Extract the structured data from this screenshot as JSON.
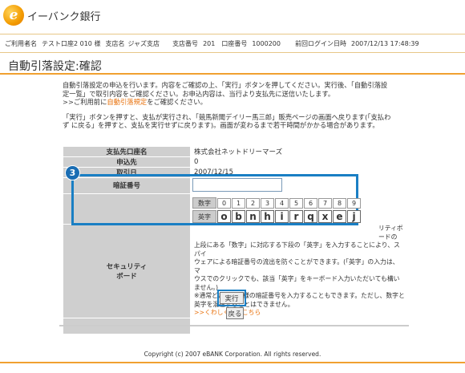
{
  "brand": {
    "logo_letter": "e",
    "name": "イーバンク銀行"
  },
  "info_bar": {
    "user_label": "ご利用者名",
    "user_name": "テスト口座2 010 様",
    "branch_label": "支店名",
    "branch_name": "ジャズ支店",
    "branch_no_label": "支店番号",
    "branch_no": "201",
    "account_label": "口座番号",
    "account_no": "1000200",
    "last_login_label": "前回ログイン日時",
    "last_login": "2007/12/13 17:48:39"
  },
  "page_title": "自動引落設定:確認",
  "description": {
    "line1": "自動引落設定の申込を行います。内容をご確認の上、「実行」ボタンを押してください。実行後、「自動引落設",
    "line2": "定一覧」で取引内容をご確認ください。お申込内容は、当行より支払先に送信いたします。",
    "line3_prefix": ">>ご利用前に",
    "line3_link": "自動引落規定",
    "line3_suffix": "をご確認ください。",
    "line4": "「実行」ボタンを押すと、支払が実行され、「競馬新聞デイリー馬三郎」販売ページの画面へ戻ります(「支払わ",
    "line5": "ず に戻る」を押すと、支払を実行せずに戻ります)。画面が変わるまで若干時間がかかる場合があります。"
  },
  "form": {
    "payee_account_label": "支払先口座名",
    "payee_account_value": "株式会社ネットドリーマーズ",
    "apply_label": "申込先",
    "apply_value": "0",
    "date_label": "取引日",
    "date_value": "2007/12/15",
    "pin_label": "暗証番号",
    "security_label_1": "セキュリティ",
    "security_label_2": "ボード"
  },
  "security_text": {
    "l1": "リティボードの",
    "l2": "上段にある「数字」に対応する下段の「英字」を入力することにより、スパイ",
    "l3": "ウェアによる暗証番号の流出を防ぐことができます。(「英字」の入力は、マ",
    "l4": "ウスでのクリックでも、該当「英字」をキーボード入力いただいても構い",
    "l5": "ません。)",
    "l6": "※通常どおりお客様の暗証番号を入力することもできます。ただし、数字と",
    "l7": "英字を混在することはできません。",
    "help_link": ">>くわしくは、こちら"
  },
  "keyboard": {
    "digit_label": "数字",
    "alpha_label": "英字",
    "digits": [
      "0",
      "1",
      "2",
      "3",
      "4",
      "5",
      "6",
      "7",
      "8",
      "9"
    ],
    "letters": [
      "o",
      "b",
      "n",
      "h",
      "i",
      "r",
      "q",
      "x",
      "e",
      "j"
    ]
  },
  "badge": "3",
  "buttons": {
    "execute": "実行",
    "back": "戻る"
  },
  "footer": "Copyright (c) 2007 eBANK Corporation. All rights reserved.",
  "colors": {
    "accent": "#f0a030",
    "highlight": "#1a7fc4",
    "label_bg": "#cfcfcf",
    "link": "#e8700a"
  }
}
